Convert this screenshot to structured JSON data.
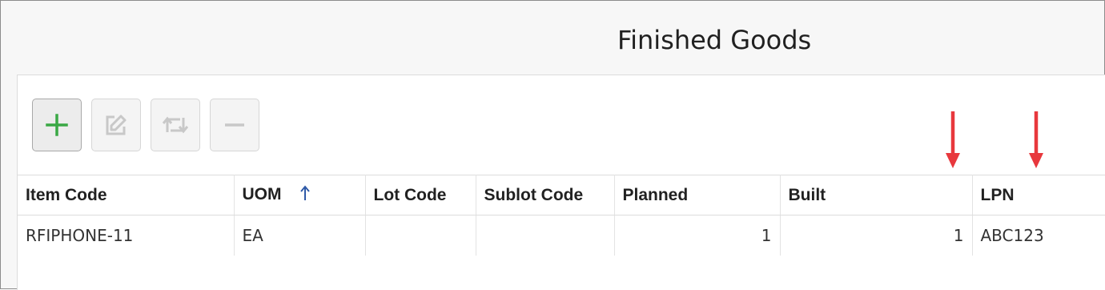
{
  "page": {
    "title": "Finished Goods"
  },
  "toolbar": {
    "buttons": [
      {
        "name": "add",
        "icon": "plus-icon",
        "enabled": true,
        "color": "#3aa845"
      },
      {
        "name": "edit",
        "icon": "edit-icon",
        "enabled": false,
        "color": "#c8c8c8"
      },
      {
        "name": "replace",
        "icon": "swap-arrows-icon",
        "enabled": false,
        "color": "#c8c8c8"
      },
      {
        "name": "remove",
        "icon": "minus-icon",
        "enabled": false,
        "color": "#c8c8c8"
      }
    ]
  },
  "annotations": {
    "arrow_color": "#e8383d",
    "arrows": [
      "built-column-arrow",
      "lpn-column-arrow"
    ]
  },
  "table": {
    "columns": [
      {
        "key": "item_code",
        "label": "Item Code"
      },
      {
        "key": "uom",
        "label": "UOM",
        "sort": "ascending"
      },
      {
        "key": "lot_code",
        "label": "Lot Code"
      },
      {
        "key": "sublot_code",
        "label": "Sublot Code"
      },
      {
        "key": "planned",
        "label": "Planned"
      },
      {
        "key": "built",
        "label": "Built"
      },
      {
        "key": "lpn",
        "label": "LPN"
      }
    ],
    "rows": [
      {
        "item_code": "RFIPHONE-11",
        "uom": "EA",
        "lot_code": "",
        "sublot_code": "",
        "planned": "1",
        "built": "1",
        "lpn": "ABC123"
      }
    ],
    "sort_color": "#2f5aa8"
  }
}
